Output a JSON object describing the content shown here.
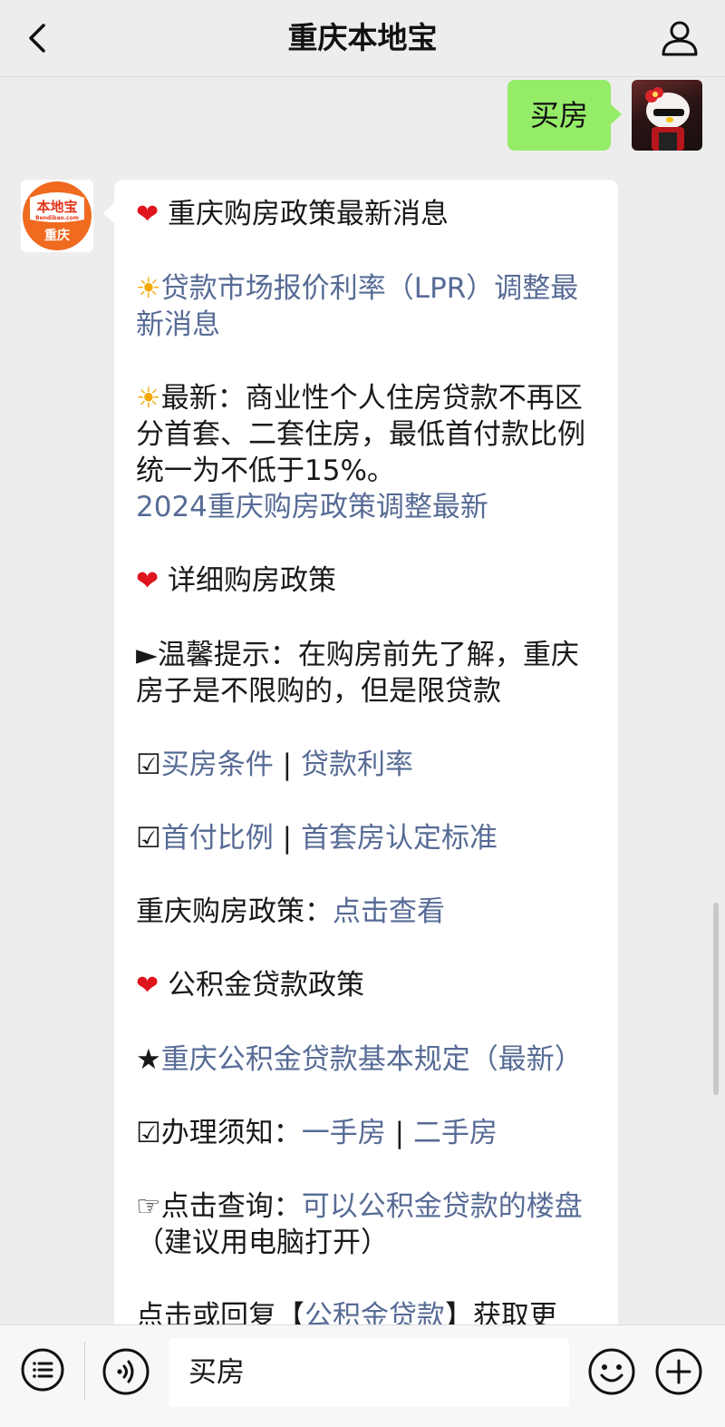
{
  "header": {
    "title": "重庆本地宝"
  },
  "sent_message": {
    "text": "买房"
  },
  "bot_avatar": {
    "line1": "本地宝",
    "line2": "Bendibao.com",
    "line3": "重庆"
  },
  "message": {
    "heading1": "重庆购房政策最新消息",
    "lpr_link": "贷款市场报价利率（LPR）调整最新消息",
    "latest_label": "最新：",
    "latest_text": "商业性个人住房贷款不再区分首套、二套住房，最低首付款比例统一为不低于15%。",
    "policy_2024_link": "2024重庆购房政策调整最新",
    "heading2": "详细购房政策",
    "tip": "►温馨提示：在购房前先了解，重庆房子是不限购的，但是限贷款",
    "row1": {
      "check": "☑",
      "link1": "买房条件",
      "sep": " | ",
      "link2": "贷款利率"
    },
    "row2": {
      "check": "☑",
      "link1": "首付比例",
      "sep": " | ",
      "link2": "首套房认定标准"
    },
    "policy_label": "重庆购房政策：",
    "policy_link": "点击查看",
    "heading3": "公积金贷款政策",
    "star": "★",
    "fund_rules_link": "重庆公积金贷款基本规定（最新）",
    "handle": {
      "label": "☑办理须知：",
      "link1": "一手房",
      "sep": " | ",
      "link2": "二手房"
    },
    "query": {
      "label": "☞点击查询：",
      "link": "可以公积金贷款的楼盘",
      "note": "（建议用电脑打开）"
    },
    "last": {
      "prefix": "点击或回复【",
      "link": "公积金贷款",
      "suffix": "】获取更"
    }
  },
  "input": {
    "value": "买房"
  },
  "icons": {
    "back": "chevron-left-icon",
    "user": "user-icon",
    "menu": "menu-list-icon",
    "voice": "voice-icon",
    "emoji": "emoji-icon",
    "plus": "plus-icon",
    "heart": "heart-icon",
    "sun": "sun-icon"
  },
  "colors": {
    "link": "#576b95",
    "sent_bubble": "#95ec69",
    "heart": "#e0141e",
    "sun": "#f5a800"
  }
}
